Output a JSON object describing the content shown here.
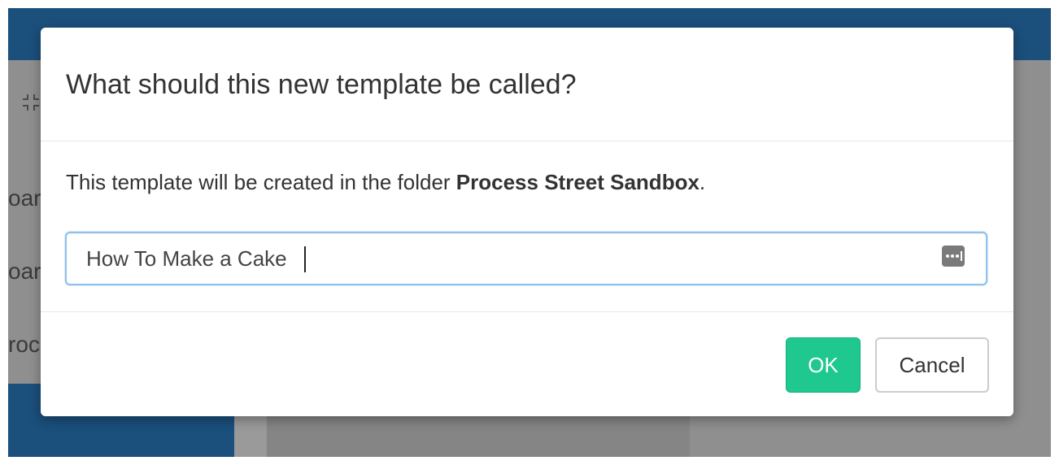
{
  "background": {
    "items": [
      "oar",
      "oar",
      "roc"
    ]
  },
  "dialog": {
    "title": "What should this new template be called?",
    "body_prefix": "This template will be created in the folder ",
    "folder_name": "Process Street Sandbox",
    "body_suffix": ".",
    "input_value": "How To Make a Cake",
    "ok_label": "OK",
    "cancel_label": "Cancel"
  },
  "colors": {
    "accent": "#1ec88e",
    "topbar": "#1b4f7c",
    "input_focus_border": "#8fc1ec"
  }
}
